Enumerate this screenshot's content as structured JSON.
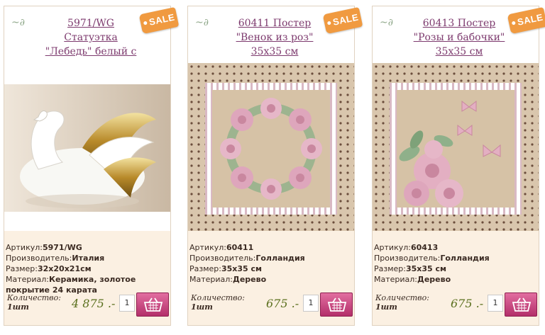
{
  "products": [
    {
      "title_lines": [
        "5971/WG",
        "Статуэтка",
        "\"Лебедь\" белый с"
      ],
      "sale": "SALE",
      "specs": [
        {
          "label": "Артикул:",
          "value": "5971/WG"
        },
        {
          "label": "Производитель:",
          "value": "Италия"
        },
        {
          "label": "Размер:",
          "value": "32x20x21см"
        },
        {
          "label": "Материал:",
          "value": "Керамика, золотое покрытие 24 карата"
        }
      ],
      "qty_label": "Количество:",
      "qty_unit": "1шт",
      "price": "4 875 .-",
      "qty_value": "1",
      "image": "swan-statuette"
    },
    {
      "title_lines": [
        "60411 Постер",
        "\"Венок из роз\"",
        "35х35 см"
      ],
      "sale": "SALE",
      "specs": [
        {
          "label": "Артикул:",
          "value": "60411"
        },
        {
          "label": "Производитель:",
          "value": "Голландия"
        },
        {
          "label": "Размер:",
          "value": "35х35 см"
        },
        {
          "label": "Материал:",
          "value": "Дерево"
        }
      ],
      "qty_label": "Количество:",
      "qty_unit": "1шт",
      "price": "675 .-",
      "qty_value": "1",
      "image": "rose-wreath-poster"
    },
    {
      "title_lines": [
        "60413 Постер",
        "\"Розы и бабочки\"",
        "35х35 см"
      ],
      "sale": "SALE",
      "specs": [
        {
          "label": "Артикул:",
          "value": "60413"
        },
        {
          "label": "Производитель:",
          "value": "Голландия"
        },
        {
          "label": "Размер:",
          "value": "35х35 см"
        },
        {
          "label": "Материал:",
          "value": "Дерево"
        }
      ],
      "qty_label": "Количество:",
      "qty_unit": "1шт",
      "price": "675 .-",
      "qty_value": "1",
      "image": "roses-butterflies-poster"
    }
  ],
  "icons": {
    "cart": "basket-icon",
    "ornament": "swirl-icon"
  },
  "colors": {
    "title": "#7d3a6e",
    "price": "#5a6f1d",
    "sale": "#f09a40",
    "cart": "#c4407e",
    "card_bg": "#fbf0e2"
  }
}
